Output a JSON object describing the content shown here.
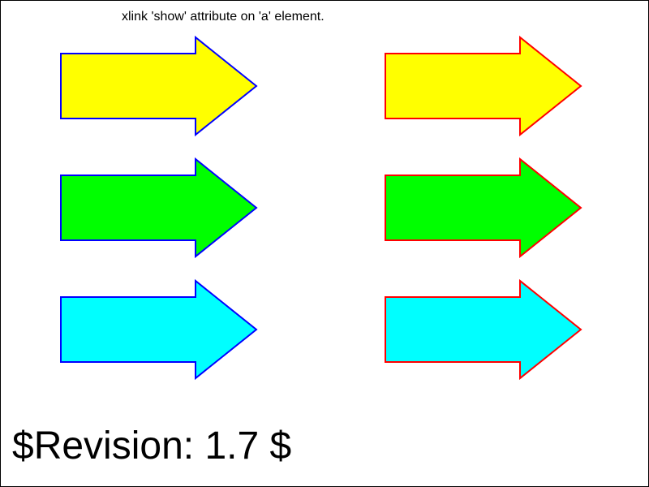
{
  "title": "xlink 'show' attribute on 'a' element.",
  "revision": "$Revision: 1.7 $",
  "arrows": [
    {
      "fill": "#ffff00",
      "stroke": "#0000ff"
    },
    {
      "fill": "#00ff00",
      "stroke": "#0000ff"
    },
    {
      "fill": "#00ffff",
      "stroke": "#0000ff"
    },
    {
      "fill": "#ffff00",
      "stroke": "#ff0000"
    },
    {
      "fill": "#00ff00",
      "stroke": "#ff0000"
    },
    {
      "fill": "#00ffff",
      "stroke": "#ff0000"
    }
  ]
}
